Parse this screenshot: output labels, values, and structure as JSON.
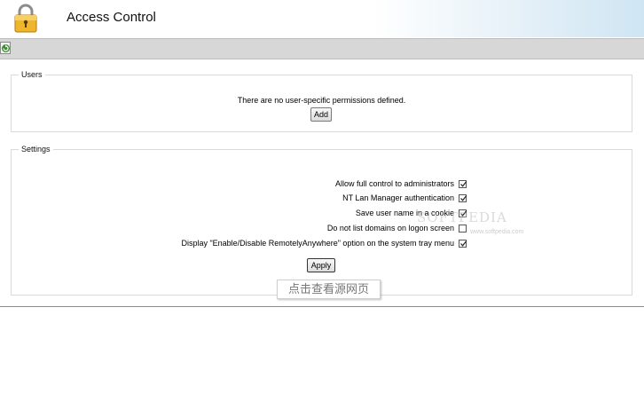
{
  "header": {
    "title": "Access Control",
    "icon": "lock-icon"
  },
  "toolbar": {
    "refresh_icon": "refresh-icon"
  },
  "users": {
    "legend": "Users",
    "message": "There are no user-specific permissions defined.",
    "add_label": "Add"
  },
  "settings": {
    "legend": "Settings",
    "options": [
      {
        "label": "Allow full control to administrators",
        "checked": true
      },
      {
        "label": "NT Lan Manager authentication",
        "checked": true
      },
      {
        "label": "Save user name in a cookie",
        "checked": true
      },
      {
        "label": "Do not list domains on logon screen",
        "checked": false
      },
      {
        "label": "Display \"Enable/Disable RemotelyAnywhere\" option on the system tray menu",
        "checked": true
      }
    ],
    "apply_label": "Apply"
  },
  "watermark": {
    "logo": "SOFTPEDIA",
    "url": "www.softpedia.com"
  },
  "source_link": "点击查看源网页"
}
